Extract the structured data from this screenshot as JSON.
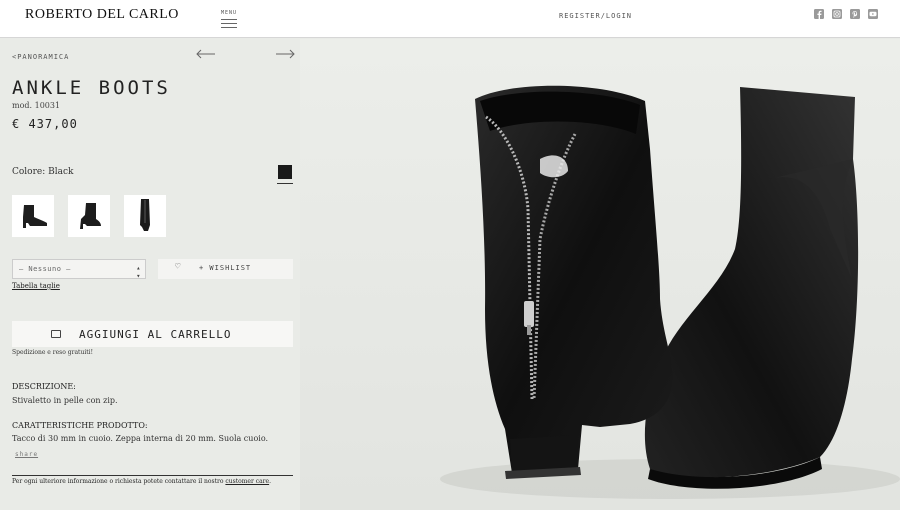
{
  "header": {
    "brand": "ROBERTO DEL CARLO",
    "menu_label": "MENU",
    "register_label": "REGISTER/LOGIN",
    "social_icons": [
      "facebook-icon",
      "instagram-icon",
      "pinterest-icon",
      "youtube-icon"
    ]
  },
  "product": {
    "breadcrumb": "<PANORAMICA",
    "title": "ANKLE BOOTS",
    "model": "mod. 10031",
    "price": "€ 437,00",
    "color_label": "Colore: Black",
    "swatch_color": "#1a1a1a",
    "size_select_value": "– Nessuno –",
    "wishlist_label": "+ WISHLIST",
    "size_table_link": "Tabella taglie",
    "add_to_cart_label": "AGGIUNGI AL CARRELLO",
    "shipping_note": "Spedizione e reso gratuiti!",
    "description_heading": "DESCRIZIONE:",
    "description_text": "Stivaletto in pelle con zip.",
    "features_heading": "CARATTERISTICHE PRODOTTO:",
    "features_text": "Tacco di 30 mm in cuoio. Zeppa interna di 20 mm. Suola cuoio.",
    "share_label": "share",
    "footer_text": "Per ogni ulteriore informazione o richiesta potete contattare il nostro",
    "footer_link": "customer care",
    "footer_end": "."
  }
}
